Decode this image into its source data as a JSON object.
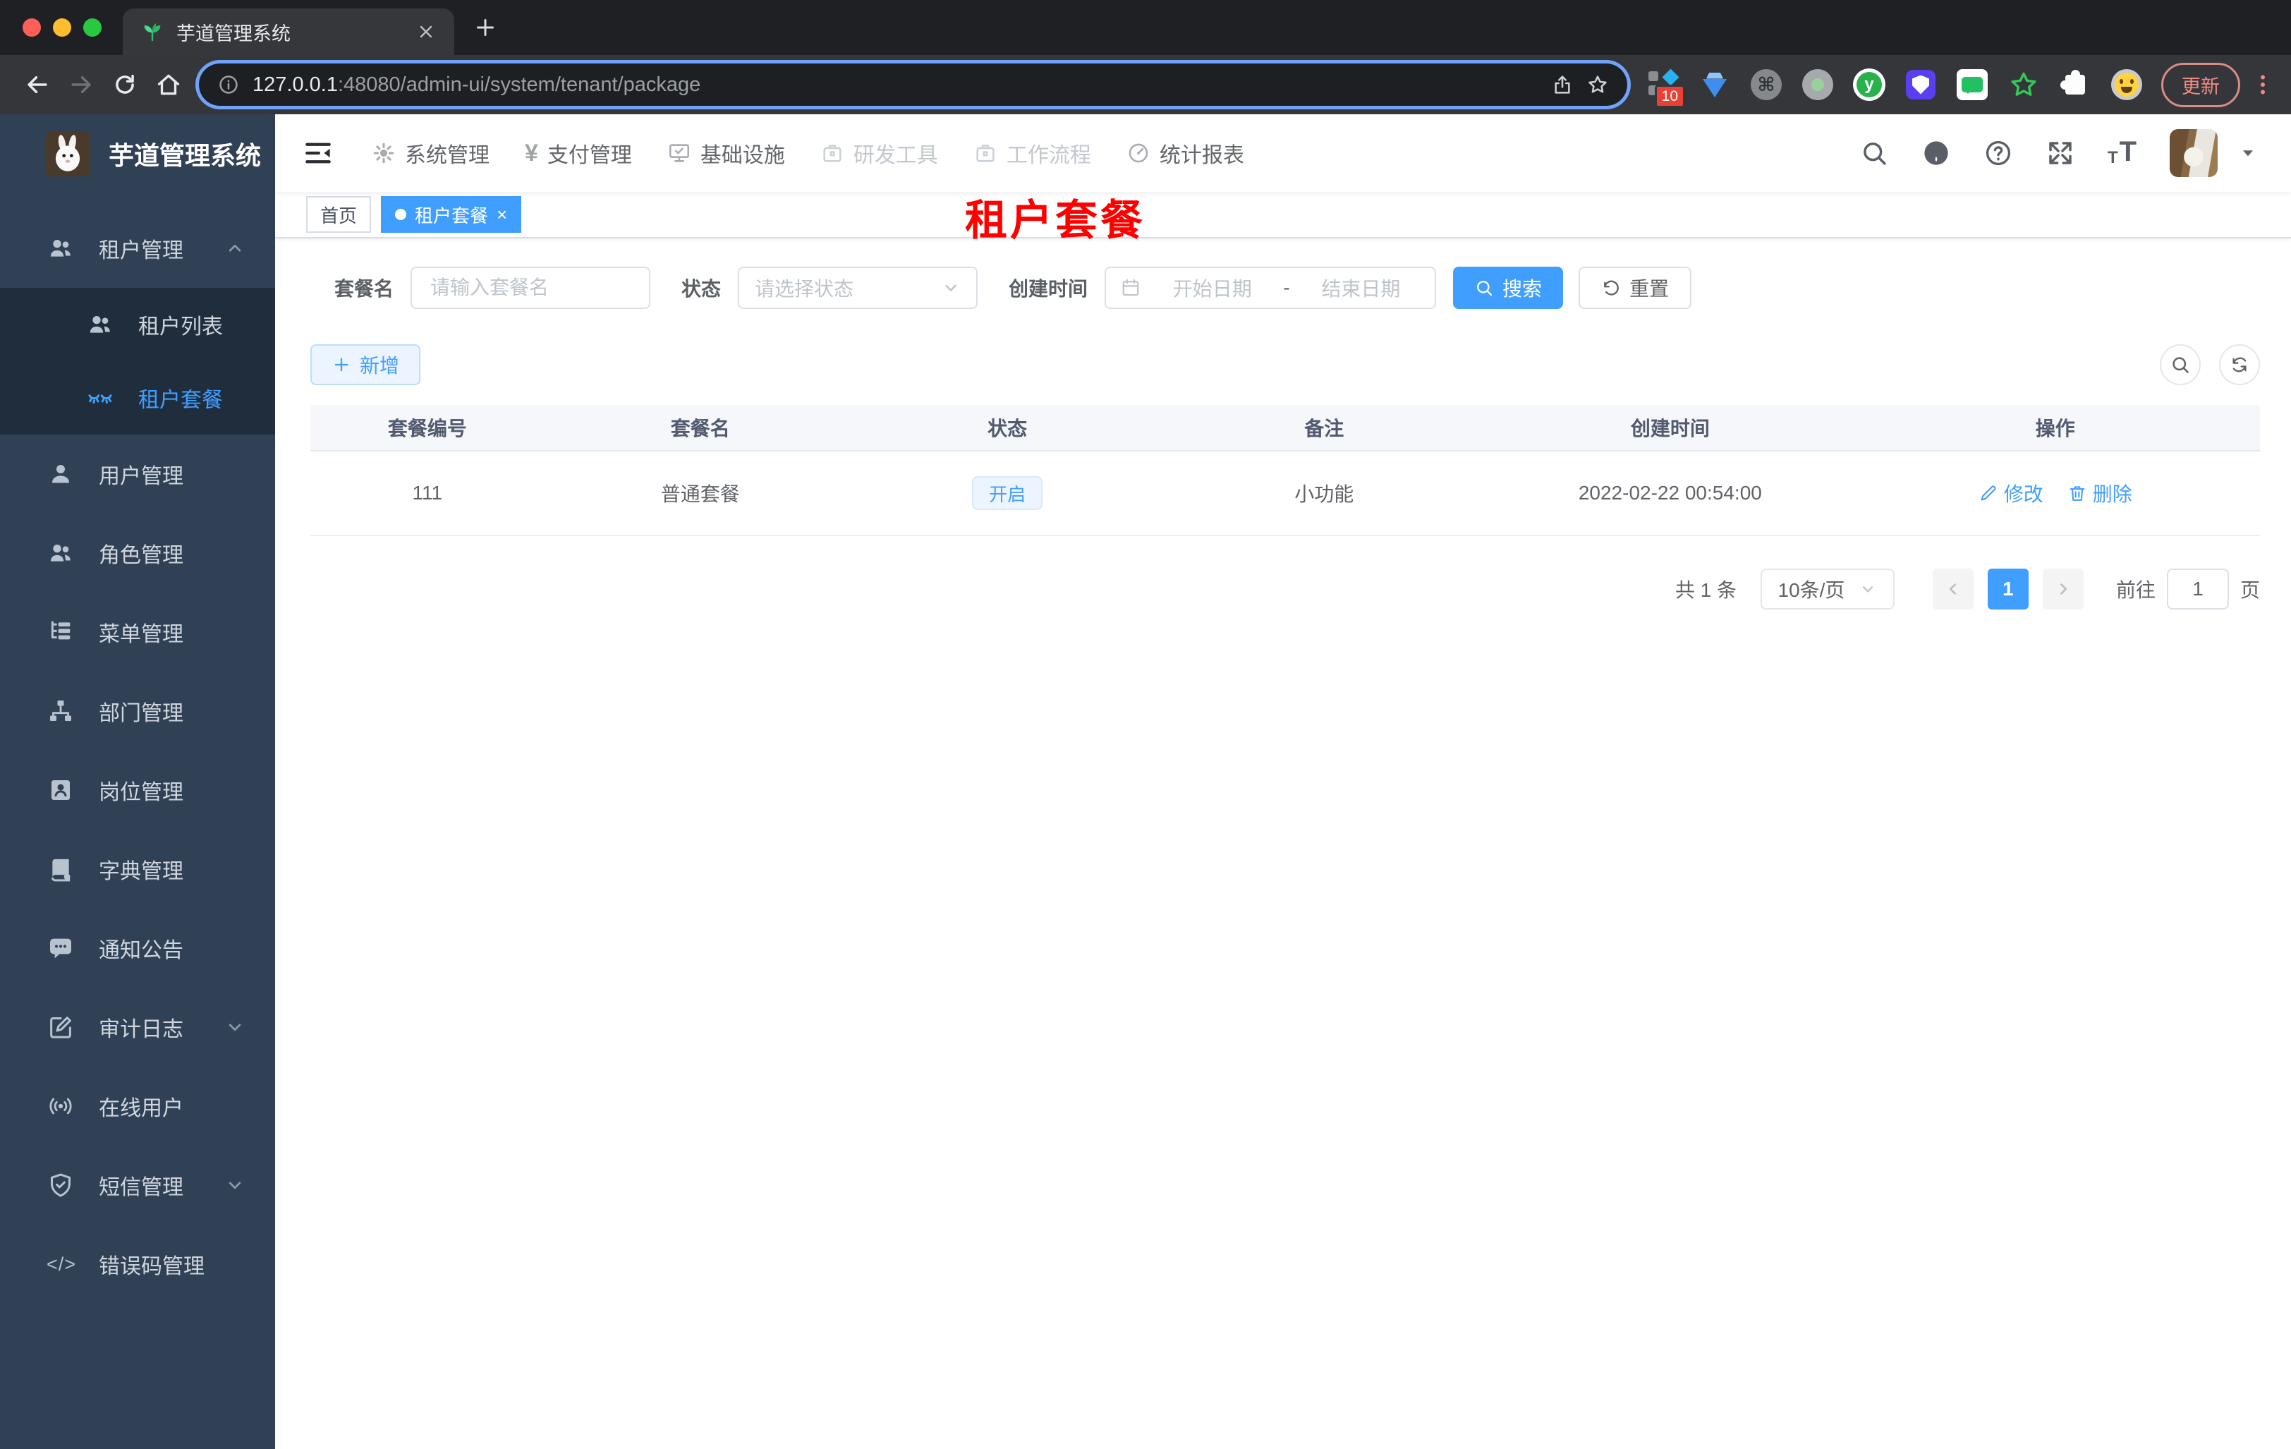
{
  "browser": {
    "tab_title": "芋道管理系统",
    "url_host": "127.0.0.1",
    "url_rest": ":48080/admin-ui/system/tenant/package",
    "update_label": "更新",
    "extension_badge": "10",
    "icons": {
      "close": "×",
      "plus": "+",
      "cmd": "⌘",
      "y_letter": "y",
      "question": "?",
      "font_small": "T",
      "font_big": "T"
    }
  },
  "app": {
    "logo_title": "芋道管理系统",
    "top_menu": [
      {
        "label": "系统管理"
      },
      {
        "label": "支付管理",
        "glyph": "¥"
      },
      {
        "label": "基础设施"
      },
      {
        "label": "研发工具"
      },
      {
        "label": "工作流程"
      },
      {
        "label": "统计报表"
      }
    ],
    "sidebar": {
      "items": [
        {
          "label": "租户管理"
        },
        {
          "label": "租户列表"
        },
        {
          "label": "租户套餐"
        },
        {
          "label": "用户管理"
        },
        {
          "label": "角色管理"
        },
        {
          "label": "菜单管理"
        },
        {
          "label": "部门管理"
        },
        {
          "label": "岗位管理"
        },
        {
          "label": "字典管理"
        },
        {
          "label": "通知公告"
        },
        {
          "label": "审计日志"
        },
        {
          "label": "在线用户"
        },
        {
          "label": "短信管理"
        },
        {
          "label": "错误码管理",
          "glyph": "</>"
        }
      ]
    },
    "tags": [
      {
        "label": "首页"
      },
      {
        "label": "租户套餐"
      }
    ],
    "watermark": "租户套餐",
    "filters": {
      "name_label": "套餐名",
      "name_placeholder": "请输入套餐名",
      "status_label": "状态",
      "status_placeholder": "请选择状态",
      "time_label": "创建时间",
      "start_placeholder": "开始日期",
      "separator": "-",
      "end_placeholder": "结束日期",
      "search_label": "搜索",
      "reset_label": "重置"
    },
    "toolbar": {
      "add_label": "新增"
    },
    "table": {
      "headers": [
        "套餐编号",
        "套餐名",
        "状态",
        "备注",
        "创建时间",
        "操作"
      ],
      "row": {
        "id": "111",
        "name": "普通套餐",
        "status": "开启",
        "remark": "小功能",
        "created": "2022-02-22 00:54:00",
        "edit_label": "修改",
        "delete_label": "删除"
      }
    },
    "pagination": {
      "total": "共 1 条",
      "page_size": "10条/页",
      "current": "1",
      "goto_label": "前往",
      "goto_value": "1",
      "unit_label": "页"
    }
  }
}
